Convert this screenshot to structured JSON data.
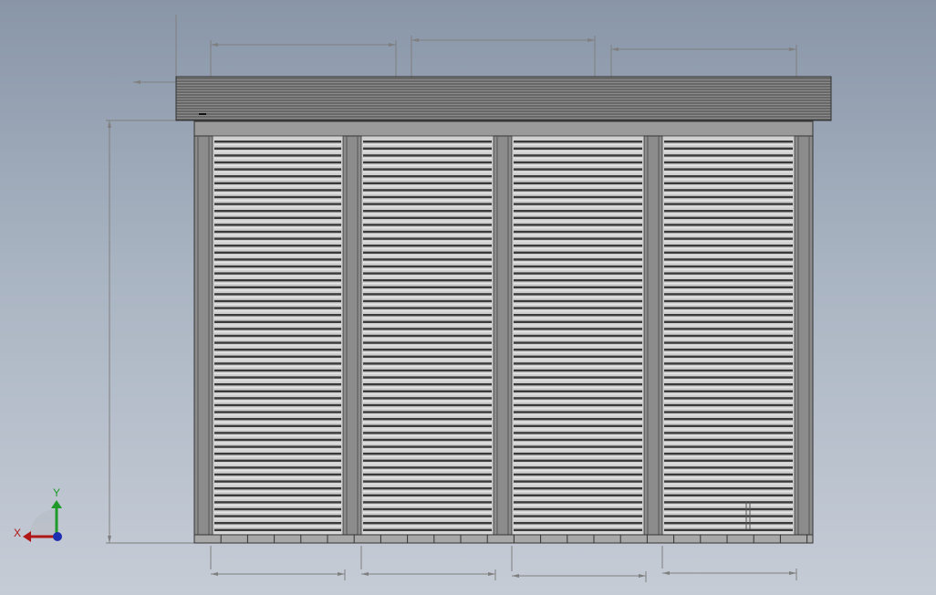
{
  "view": {
    "background_top": "#8996a8",
    "background_bottom": "#c6ccd6"
  },
  "model": {
    "description_name": "rolling-shutter-door-assembly",
    "bays": 4,
    "frame_color": "#8c8c8c",
    "slat_color": "#cfcfcf",
    "roof_color": "#8a8a8a",
    "dimension_line_color": "#7f7f7f"
  },
  "triad": {
    "x_label": "X",
    "y_label": "Y",
    "x_color": "#b01818",
    "y_color": "#1f9a2a",
    "z_color": "#1c2fb0"
  }
}
